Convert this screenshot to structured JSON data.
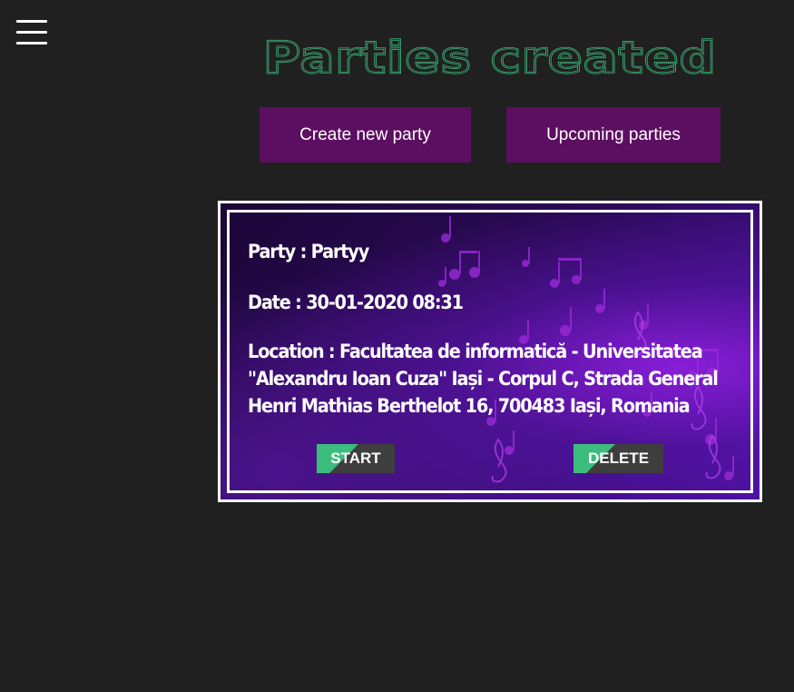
{
  "nav": {
    "menu_icon": "hamburger-menu-icon"
  },
  "header": {
    "title": "Parties created"
  },
  "actions": {
    "create_label": "Create new party",
    "upcoming_label": "Upcoming parties"
  },
  "party_card": {
    "party": "Party : Partyy",
    "date": "Date : 30-01-2020 08:31",
    "location": "Location : Facultatea de informatică - Universitatea \"Alexandru Ioan Cuza\" Iași - Corpul C, Strada General Henri Mathias Berthelot 16, 700483 Iași, Romania",
    "start_label": "START",
    "delete_label": "DELETE"
  },
  "colors": {
    "background": "#202020",
    "title_green": "#3dbd7d",
    "button_purple": "#5c0f61",
    "card_accent": "#8c1edc"
  }
}
